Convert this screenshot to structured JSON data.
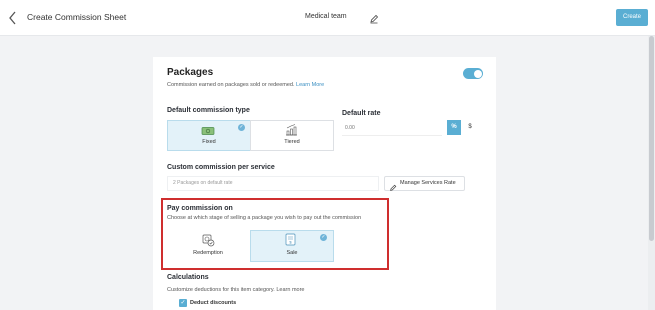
{
  "header": {
    "back_icon": "chevron-left-icon",
    "title": "Create Commission Sheet",
    "sheet_name": "Medical team",
    "create_label": "Create"
  },
  "packages": {
    "title": "Packages",
    "description": "Commission earned on packages sold or redeemed.",
    "learn_more": "Learn More",
    "enabled": true
  },
  "default_commission_type": {
    "label": "Default commission type",
    "options": [
      {
        "label": "Fixed",
        "selected": true,
        "icon": "cash-icon"
      },
      {
        "label": "Tiered",
        "selected": false,
        "icon": "tiered-chart-icon"
      }
    ]
  },
  "default_rate": {
    "label": "Default rate",
    "placeholder": "0.00",
    "percent_label": "%",
    "dollar_label": "$"
  },
  "custom_commission": {
    "label": "Custom commission per service",
    "field_text": "2 Packages on default rate",
    "manage_label": "Manage Services Rate"
  },
  "pay_commission": {
    "title": "Pay commission on",
    "description": "Choose at which stage of selling a package you wish to pay out the commission",
    "options": [
      {
        "label": "Redemption",
        "selected": false,
        "icon": "redemption-icon"
      },
      {
        "label": "Sale",
        "selected": true,
        "icon": "sale-tag-icon"
      }
    ]
  },
  "calculations": {
    "title": "Calculations",
    "description": "Customize deductions for this item category.",
    "learn_more": "Learn more",
    "deduct_discounts_label": "Deduct discounts",
    "deduct_discounts_checked": true
  },
  "colors": {
    "accent": "#5aaed3",
    "selected_bg": "#e3f2f9",
    "highlight_box": "#cf2e2e"
  }
}
